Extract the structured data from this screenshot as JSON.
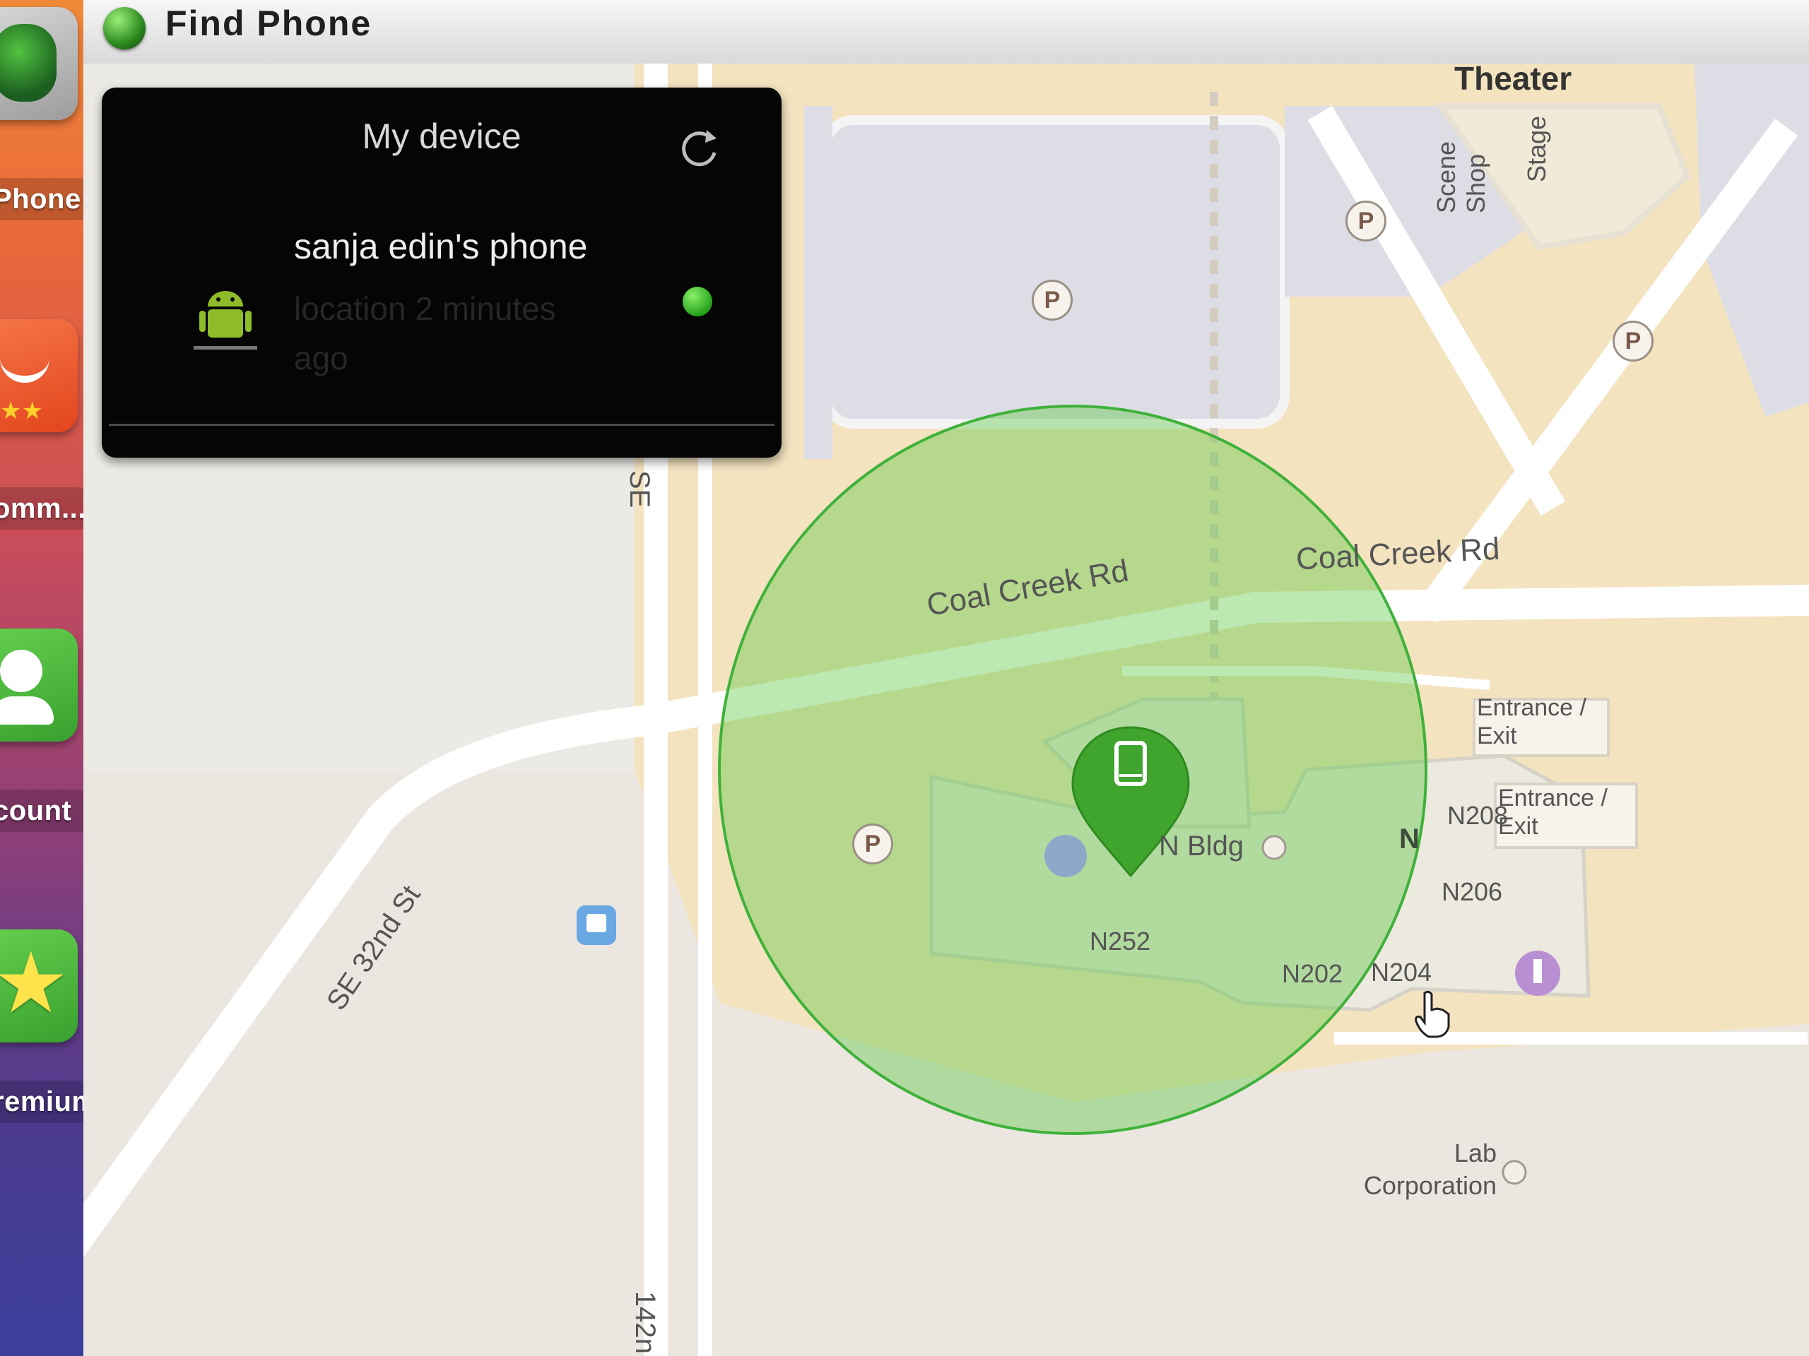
{
  "window": {
    "title": "Find Phone"
  },
  "sidebar": {
    "items": [
      {
        "label": "Phone",
        "icon": "check-icon",
        "color": "#2f8f3a"
      },
      {
        "label": "omm...",
        "icon": "rating-bag-icon",
        "color": "#ef5a2a"
      },
      {
        "label": "count",
        "icon": "person-icon",
        "color": "#4caf3a"
      },
      {
        "label": "remium",
        "icon": "star-icon",
        "color": "#4caf3a"
      }
    ]
  },
  "device_panel": {
    "title": "My device",
    "device_name": "sanja edin's phone",
    "status_text": "location 2 minutes ago",
    "online": true,
    "status_color": "#2ea21f"
  },
  "map": {
    "labels": {
      "road_coal_creek_1": "Coal Creek Rd",
      "road_coal_creek_2": "Coal Creek Rd",
      "road_se32": "SE 32nd St",
      "road_se": "SE",
      "road_142": "142n",
      "theater": "Theater",
      "scene_shop": "Scene Shop",
      "stage": "Stage",
      "entrance1": "Entrance / Exit",
      "entrance2": "Entrance / Exit",
      "n208": "N208",
      "n206": "N206",
      "n204": "N204",
      "n202": "N202",
      "n252": "N252",
      "n_bldg": "N Bldg",
      "n": "N",
      "lab": "Lab Corporation",
      "parking": "P"
    },
    "accuracy_circle_color": "#4cbf3a"
  }
}
